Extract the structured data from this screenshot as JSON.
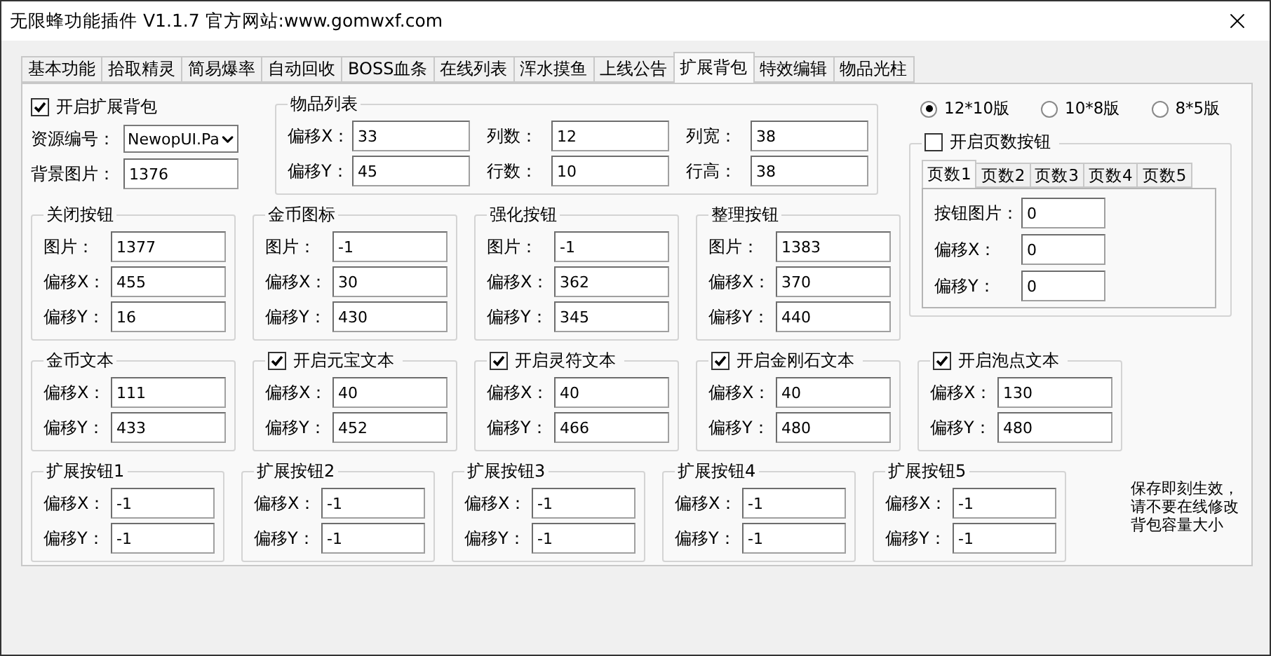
{
  "window": {
    "title": "无限蜂功能插件 V1.1.7  官方网站:www.gomwxf.com"
  },
  "tabs": [
    {
      "label": "基本功能",
      "selected": false
    },
    {
      "label": "拾取精灵",
      "selected": false
    },
    {
      "label": "简易爆率",
      "selected": false
    },
    {
      "label": "自动回收",
      "selected": false
    },
    {
      "label": "BOSS血条",
      "selected": false
    },
    {
      "label": "在线列表",
      "selected": false
    },
    {
      "label": "浑水摸鱼",
      "selected": false
    },
    {
      "label": "上线公告",
      "selected": false
    },
    {
      "label": "扩展背包",
      "selected": true
    },
    {
      "label": "特效编辑",
      "selected": false
    },
    {
      "label": "物品光柱",
      "selected": false
    }
  ],
  "enable_bag": {
    "label": "开启扩展背包",
    "checked": true
  },
  "resource": {
    "label": "资源编号：",
    "value": "NewopUI.Pa"
  },
  "background": {
    "label": "背景图片：",
    "value": "1376"
  },
  "item_list": {
    "title": "物品列表",
    "fields": [
      {
        "label": "偏移X：",
        "value": "33"
      },
      {
        "label": "列数：",
        "value": "12"
      },
      {
        "label": "列宽：",
        "value": "38"
      },
      {
        "label": "偏移Y：",
        "value": "45"
      },
      {
        "label": "行数：",
        "value": "10"
      },
      {
        "label": "行高：",
        "value": "38"
      }
    ]
  },
  "layout_options": [
    {
      "label": "12*10版",
      "selected": true
    },
    {
      "label": "10*8版",
      "selected": false
    },
    {
      "label": "8*5版",
      "selected": false
    }
  ],
  "page_buttons": {
    "label": "开启页数按钮",
    "checked": false,
    "tabs": [
      {
        "label": "页数1",
        "selected": true
      },
      {
        "label": "页数2",
        "selected": false
      },
      {
        "label": "页数3",
        "selected": false
      },
      {
        "label": "页数4",
        "selected": false
      },
      {
        "label": "页数5",
        "selected": false
      }
    ],
    "fields": [
      {
        "label": "按钮图片：",
        "value": "0"
      },
      {
        "label": "偏移X：",
        "value": "0"
      },
      {
        "label": "偏移Y：",
        "value": "0"
      }
    ]
  },
  "button_groups": [
    {
      "kind": "plain",
      "title": "关闭按钮",
      "fields": [
        {
          "label": "图片：",
          "value": "1377"
        },
        {
          "label": "偏移X：",
          "value": "455"
        },
        {
          "label": "偏移Y：",
          "value": "16"
        }
      ]
    },
    {
      "kind": "plain",
      "title": "金币图标",
      "fields": [
        {
          "label": "图片：",
          "value": "-1"
        },
        {
          "label": "偏移X：",
          "value": "30"
        },
        {
          "label": "偏移Y：",
          "value": "430"
        }
      ]
    },
    {
      "kind": "plain",
      "title": "强化按钮",
      "fields": [
        {
          "label": "图片：",
          "value": "-1"
        },
        {
          "label": "偏移X：",
          "value": "362"
        },
        {
          "label": "偏移Y：",
          "value": "345"
        }
      ]
    },
    {
      "kind": "plain",
      "title": "整理按钮",
      "fields": [
        {
          "label": "图片：",
          "value": "1383"
        },
        {
          "label": "偏移X：",
          "value": "370"
        },
        {
          "label": "偏移Y：",
          "value": "440"
        }
      ]
    }
  ],
  "text_groups": [
    {
      "kind": "plain",
      "title": "金币文本",
      "fields": [
        {
          "label": "偏移X：",
          "value": "111"
        },
        {
          "label": "偏移Y：",
          "value": "433"
        }
      ]
    },
    {
      "kind": "checkbox",
      "title": "开启元宝文本",
      "checked": true,
      "fields": [
        {
          "label": "偏移X：",
          "value": "40"
        },
        {
          "label": "偏移Y：",
          "value": "452"
        }
      ]
    },
    {
      "kind": "checkbox",
      "title": "开启灵符文本",
      "checked": true,
      "fields": [
        {
          "label": "偏移X：",
          "value": "40"
        },
        {
          "label": "偏移Y：",
          "value": "466"
        }
      ]
    },
    {
      "kind": "checkbox",
      "title": "开启金刚石文本",
      "checked": true,
      "fields": [
        {
          "label": "偏移X：",
          "value": "40"
        },
        {
          "label": "偏移Y：",
          "value": "480"
        }
      ]
    },
    {
      "kind": "checkbox",
      "title": "开启泡点文本",
      "checked": true,
      "fields": [
        {
          "label": "偏移X：",
          "value": "130"
        },
        {
          "label": "偏移Y：",
          "value": "480"
        }
      ]
    }
  ],
  "ext_groups": [
    {
      "kind": "plain",
      "title": "扩展按钮1",
      "fields": [
        {
          "label": "偏移X：",
          "value": "-1"
        },
        {
          "label": "偏移Y：",
          "value": "-1"
        }
      ]
    },
    {
      "kind": "plain",
      "title": "扩展按钮2",
      "fields": [
        {
          "label": "偏移X：",
          "value": "-1"
        },
        {
          "label": "偏移Y：",
          "value": "-1"
        }
      ]
    },
    {
      "kind": "plain",
      "title": "扩展按钮3",
      "fields": [
        {
          "label": "偏移X：",
          "value": "-1"
        },
        {
          "label": "偏移Y：",
          "value": "-1"
        }
      ]
    },
    {
      "kind": "plain",
      "title": "扩展按钮4",
      "fields": [
        {
          "label": "偏移X：",
          "value": "-1"
        },
        {
          "label": "偏移Y：",
          "value": "-1"
        }
      ]
    },
    {
      "kind": "plain",
      "title": "扩展按钮5",
      "fields": [
        {
          "label": "偏移X：",
          "value": "-1"
        },
        {
          "label": "偏移Y：",
          "value": "-1"
        }
      ]
    }
  ],
  "note": "保存即刻生效，请不要在线修改背包容量大小"
}
